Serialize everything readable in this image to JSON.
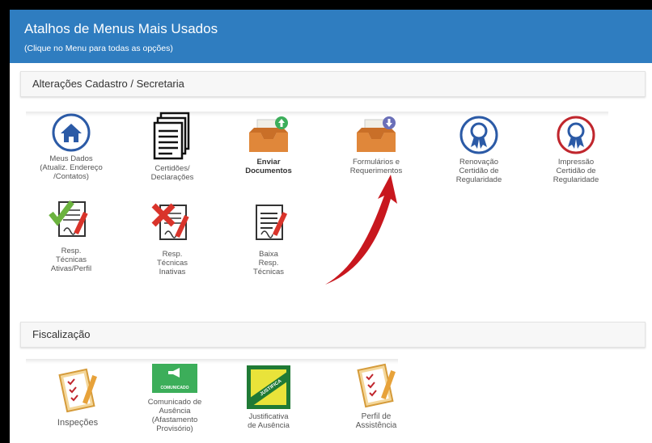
{
  "header": {
    "title": "Atalhos de Menus Mais Usados",
    "subtitle": "(Clique no Menu para todas as opções)"
  },
  "sections": {
    "cadastro": {
      "title": "Alterações Cadastro / Secretaria",
      "items": [
        {
          "label": "Meus Dados\n(Atualiz. Endereço\n/Contatos)",
          "icon": "home-icon"
        },
        {
          "label": "Certidões/\nDeclarações",
          "icon": "documents-icon"
        },
        {
          "label": "Enviar\nDocumentos",
          "icon": "upload-box-icon"
        },
        {
          "label": "Formulários e\nRequerimentos",
          "icon": "download-box-icon"
        },
        {
          "label": "Renovação\nCertidão de\nRegularidade",
          "icon": "award-ribbon-icon"
        },
        {
          "label": "Impressão\nCertidão de\nRegularidade",
          "icon": "award-ribbon-icon"
        },
        {
          "label": "Resp.\nTécnicas\nAtivas/Perfil",
          "icon": "signed-document-check-icon"
        },
        {
          "label": "Resp.\nTécnicas\nInativas",
          "icon": "signed-document-x-icon"
        },
        {
          "label": "Baixa\nResp.\nTécnicas",
          "icon": "signed-document-icon"
        }
      ]
    },
    "fiscalizacao": {
      "title": "Fiscalização",
      "items": [
        {
          "label": "Inspeções",
          "icon": "checklist-icon"
        },
        {
          "label": "Comunicado de\nAusência\n(Afastamento\nProvisório)",
          "icon": "megaphone-icon",
          "badge": "COMUNICADO"
        },
        {
          "label": "Justificativa\nde Ausência",
          "icon": "justification-icon",
          "badge": "JUSTIFICA"
        },
        {
          "label": "Perfil de\nAssistência",
          "icon": "checklist-icon"
        }
      ]
    }
  },
  "colors": {
    "header": "#2f7dc0",
    "accent_red": "#c0262d",
    "green": "#3cae5a",
    "orange": "#e0873a"
  }
}
